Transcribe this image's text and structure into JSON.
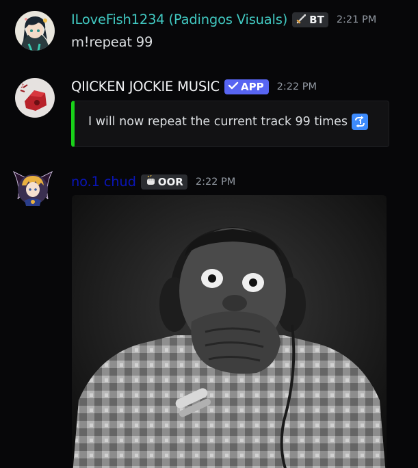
{
  "messages": [
    {
      "author": "ILoveFish1234 (Padingos Visuals)",
      "author_color": "#41c8c1",
      "tag": "BT",
      "tag_icon": "sword-icon",
      "timestamp": "2:21 PM",
      "content": "m!repeat 99"
    },
    {
      "author": "QIICKEN JOCKIE MUSIC",
      "author_color": "#f2f3f5",
      "tag": "APP",
      "tag_icon": "checkmark-icon",
      "timestamp": "2:22 PM",
      "embed": {
        "text": "I will now repeat the current track 99 times",
        "accent": "#19d119",
        "emoji": "repeat-one-icon"
      }
    },
    {
      "author": "no.1 chud",
      "author_color": "#0a15b8",
      "tag": "OOR",
      "tag_icon": "fist-icon",
      "timestamp": "2:22 PM",
      "attachment": "image"
    }
  ]
}
